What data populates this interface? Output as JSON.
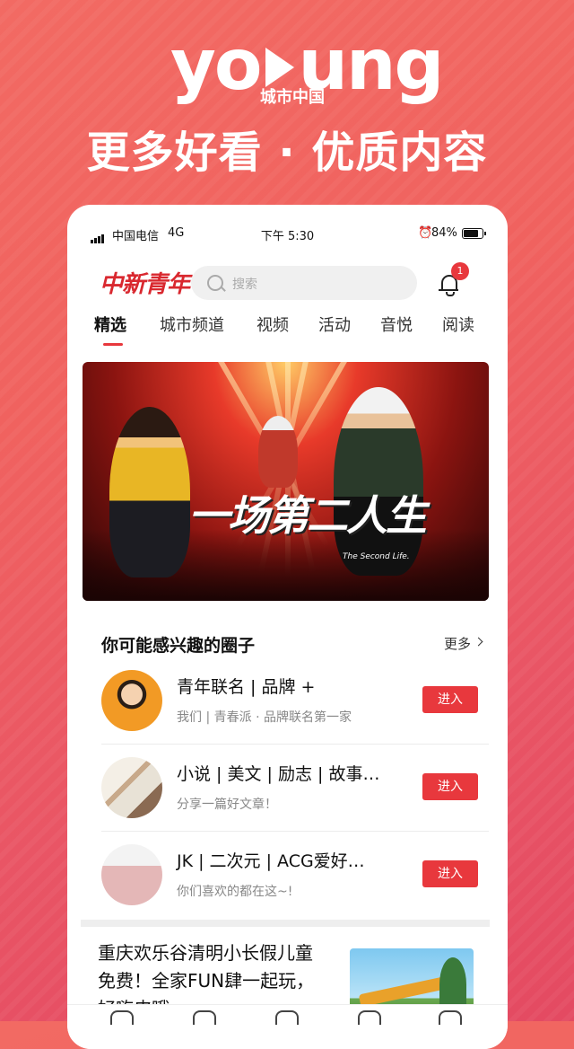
{
  "promo": {
    "brand_word": "young",
    "brand_sub": "城市中国",
    "headline": "更多好看 · 优质内容"
  },
  "status_bar": {
    "carrier": "中国电信",
    "network": "4G",
    "time": "下午 5:30",
    "battery": "84%"
  },
  "header": {
    "logo_text": "中新青年",
    "search_placeholder": "搜索",
    "notification_count": "1"
  },
  "tabs": [
    {
      "label": "精选",
      "active": true
    },
    {
      "label": "城市频道"
    },
    {
      "label": "视频"
    },
    {
      "label": "活动"
    },
    {
      "label": "音悦"
    },
    {
      "label": "阅读"
    }
  ],
  "banner": {
    "title": "一场第二人生",
    "subtitle": "The Second Life."
  },
  "circles_section": {
    "title": "你可能感兴趣的圈子",
    "more_label": "更多",
    "items": [
      {
        "name": "青年联名 | 品牌 +",
        "desc": "我们 | 青春派 · 品牌联名第一家",
        "button": "进入"
      },
      {
        "name": "小说 | 美文 | 励志 | 故事…",
        "desc": "分享一篇好文章！",
        "button": "进入"
      },
      {
        "name": " JK | 二次元 |  ACG爱好…",
        "desc": "你们喜欢的都在这~!",
        "button": "进入"
      }
    ]
  },
  "news": {
    "title": "重庆欢乐谷清明小长假儿童免费！全家FUN肆一起玩，好嗨皮哦"
  },
  "colors": {
    "accent": "#e8383d",
    "background_gradient_start": "#f26a63",
    "background_gradient_end": "#e44a62"
  }
}
